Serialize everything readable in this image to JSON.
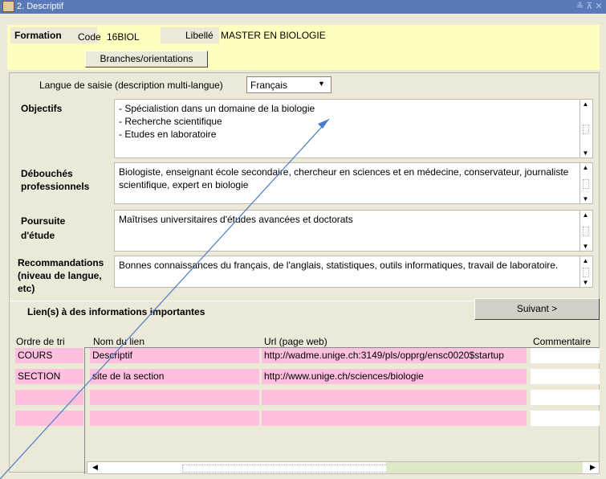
{
  "window": {
    "title": "2. Descriptif",
    "controls": "≚ ⊼ ✕"
  },
  "formation": {
    "section_label": "Formation",
    "code_label": "Code",
    "code_value": "16BIOL",
    "libelle_label": "Libellé",
    "libelle_value": "MASTER EN BIOLOGIE",
    "branches_button": "Branches/orientations"
  },
  "language": {
    "label": "Langue de saisie (description multi-langue)",
    "selected": "Français"
  },
  "fields": {
    "objectifs": {
      "label": "Objectifs",
      "text": "- Spécialistion dans un domaine de la biologie\n- Recherche scientifique\n- Etudes en laboratoire"
    },
    "debouches": {
      "label": "Débouchés professionnels",
      "text": "Biologiste, enseignant école secondaire, chercheur en sciences et en médecine, conservateur, journaliste scientifique, expert en biologie"
    },
    "poursuite": {
      "label": "Poursuite d'étude",
      "text": "Maîtrises universitaires d'études avancées et doctorats"
    },
    "recommandations": {
      "label": "Recommandations (niveau de langue, etc)",
      "text": "Bonnes connaissances du français, de l'anglais, statistiques, outils informatiques, travail de laboratoire."
    }
  },
  "links": {
    "section_label": "Lien(s) à des informations importantes",
    "next_button": "Suivant >",
    "columns": {
      "ordre": "Ordre de tri",
      "nom": "Nom du lien",
      "url": "Url (page web)",
      "commentaire": "Commentaire"
    },
    "rows": [
      {
        "ordre": "COURS",
        "nom": "Descriptif",
        "url": "http://wadme.unige.ch:3149/pls/opprg/ensc0020$startup",
        "commentaire": ""
      },
      {
        "ordre": "SECTION",
        "nom": "site de la section",
        "url": "http://www.unige.ch/sciences/biologie",
        "commentaire": ""
      },
      {
        "ordre": "",
        "nom": "",
        "url": "",
        "commentaire": ""
      },
      {
        "ordre": "",
        "nom": "",
        "url": "",
        "commentaire": ""
      }
    ]
  },
  "colors": {
    "titlebar": "#5a79b8",
    "panel": "#ece9d8",
    "yellow_field": "#ffffc0",
    "pink_cell": "#ffc0e0",
    "pointer_line": "#4a7acb"
  }
}
